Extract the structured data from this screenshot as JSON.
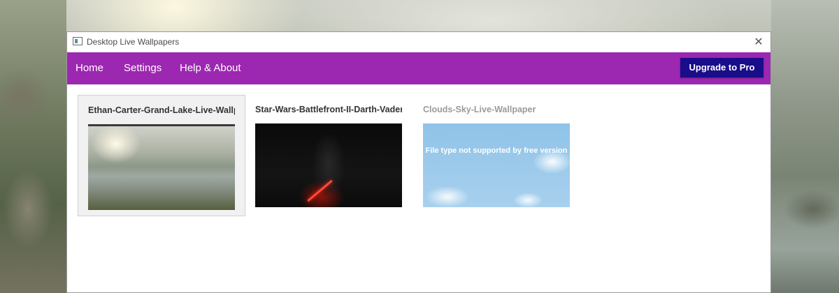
{
  "window": {
    "title": "Desktop Live Wallpapers",
    "close_glyph": "✕"
  },
  "nav": {
    "items": [
      {
        "label": "Home"
      },
      {
        "label": "Settings"
      },
      {
        "label": "Help & About"
      }
    ],
    "upgrade_label": "Upgrade to Pro",
    "accent_color": "#9c27b0",
    "upgrade_color": "#1a0d8a"
  },
  "wallpapers": [
    {
      "title": "Ethan-Carter-Grand-Lake-Live-Wallpaper",
      "selected": true
    },
    {
      "title": "Star-Wars-Battlefront-II-Darth-Vader-Live-Wallpaper",
      "selected": false
    },
    {
      "title": "Clouds-Sky-Live-Wallpaper",
      "selected": false,
      "overlay_text": "File type not supported by free version"
    }
  ],
  "icons": {
    "app": "app-window-icon",
    "close": "close-icon"
  }
}
